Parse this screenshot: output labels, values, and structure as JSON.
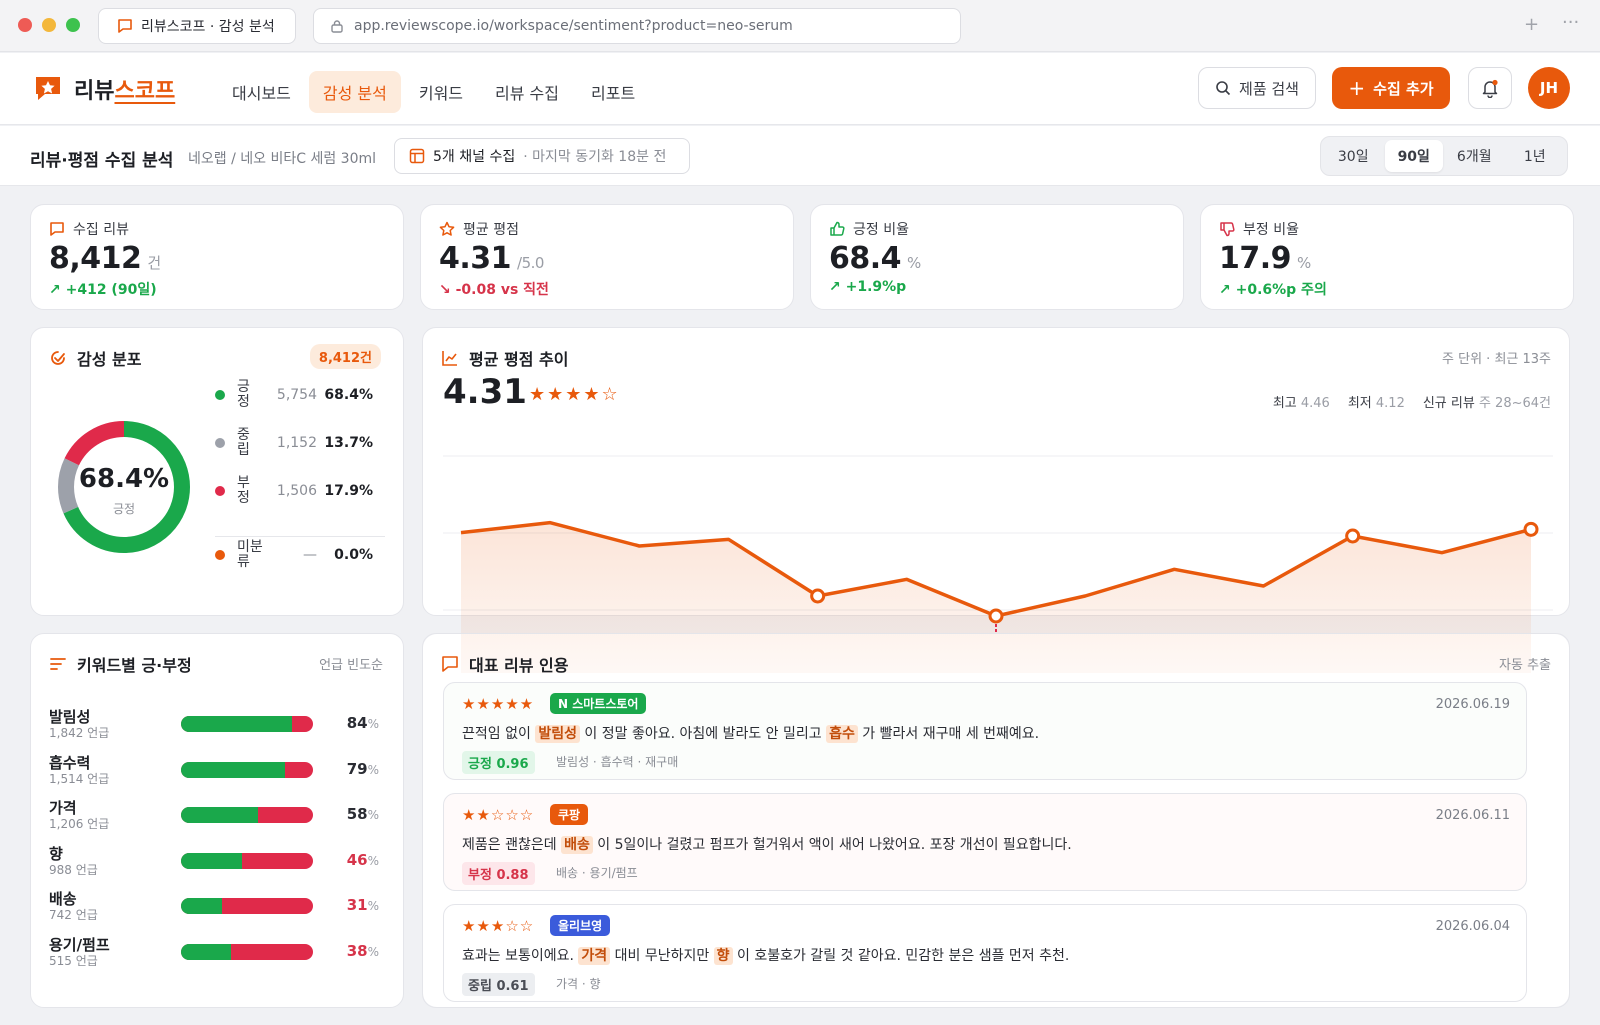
{
  "browser": {
    "tab_title": "리뷰스코프 · 감성 분석",
    "url": "app.reviewscope.io/workspace/sentiment?product=neo-serum"
  },
  "nav": {
    "logo_main": "리뷰",
    "logo_accent": "스코프",
    "items": [
      "대시보드",
      "감성 분석",
      "키워드",
      "리뷰 수집",
      "리포트"
    ],
    "active": 1,
    "search_label": "제품 검색",
    "add_label": "수집 추가",
    "avatar": "JH"
  },
  "subbar": {
    "title": "리뷰·평점 수집 분석",
    "path": "네오랩 / 네오 비타C 세럼 30ml",
    "chip_main": "5개 채널 수집",
    "chip_sub": "· 마지막 동기화 18분 전",
    "ranges": [
      "30일",
      "90일",
      "6개월",
      "1년"
    ],
    "range_selected": 1
  },
  "kpis": [
    {
      "label": "수집 리뷰",
      "value": "8,412",
      "unit": "건",
      "delta": "↗ +412 (90일)",
      "dir": "up",
      "icon": "message-icon"
    },
    {
      "label": "평균 평점",
      "value": "4.31",
      "unit": "/5.0",
      "delta": "↘ -0.08 vs 직전",
      "dir": "down",
      "icon": "star-icon"
    },
    {
      "label": "긍정 비율",
      "value": "68.4",
      "unit": "%",
      "delta": "↗ +1.9%p",
      "dir": "up",
      "icon": "thumbs-up-icon"
    },
    {
      "label": "부정 비율",
      "value": "17.9",
      "unit": "%",
      "delta": "↗ +0.6%p 주의",
      "dir": "up",
      "icon": "thumbs-down-icon"
    }
  ],
  "sentiment": {
    "title": "감성 분포",
    "badge": "8,412건",
    "center_value": "68.4%",
    "center_label": "긍정",
    "rows": [
      {
        "name": "긍정",
        "count": "5,754",
        "pct": "68.4%",
        "color": "#1aa84b",
        "share": 68.4
      },
      {
        "name": "중립",
        "count": "1,152",
        "pct": "13.7%",
        "color": "#9da1aa",
        "share": 13.7
      },
      {
        "name": "부정",
        "count": "1,506",
        "pct": "17.9%",
        "color": "#e02a4a",
        "share": 17.9
      },
      {
        "name": "미분류",
        "count": "—",
        "pct": "0.0%",
        "color": "#e8590c",
        "share": 0
      }
    ]
  },
  "trend": {
    "title": "평균 평점 추이",
    "note": "주 단위 · 최근 13주",
    "value": "4.31",
    "stars": "★★★★☆",
    "max_label": "최고",
    "max_value": "4.46",
    "min_label": "최저",
    "min_value": "4.12",
    "new_label": "신규 리뷰",
    "new_value": "주 28~64건"
  },
  "chart_data": {
    "type": "line",
    "series": [
      {
        "values": [
          4.37,
          4.4,
          4.33,
          4.35,
          4.18,
          4.23,
          4.12,
          4.18,
          4.26,
          4.21,
          4.36,
          4.31,
          4.38
        ]
      }
    ],
    "ylim": [
      4.0,
      4.6
    ],
    "grid": true,
    "markers": [
      4,
      6,
      10,
      12
    ]
  },
  "keywords": {
    "title": "키워드별 긍·부정",
    "note": "언급 빈도순",
    "items": [
      {
        "name": "발림성",
        "mentions": "1,842 언급",
        "pct": "84",
        "tone": "pos"
      },
      {
        "name": "흡수력",
        "mentions": "1,514 언급",
        "pct": "79",
        "tone": "pos"
      },
      {
        "name": "가격",
        "mentions": "1,206 언급",
        "pct": "58",
        "tone": "pos"
      },
      {
        "name": "향",
        "mentions": "988 언급",
        "pct": "46",
        "tone": "neg"
      },
      {
        "name": "배송",
        "mentions": "742 언급",
        "pct": "31",
        "tone": "neg"
      },
      {
        "name": "용기/펌프",
        "mentions": "515 언급",
        "pct": "38",
        "tone": "neg"
      }
    ]
  },
  "quotes": {
    "title": "대표 리뷰 인용",
    "note": "자동 추출",
    "items": [
      {
        "stars": "★★★★★",
        "source": "N 스마트스토어",
        "source_color": "#1aa84b",
        "date": "2026.06.19",
        "parts": [
          "끈적임 없이 ",
          "발림성",
          " 이 정말 좋아요. 아침에 발라도 안 밀리고 ",
          "흡수",
          " 가 빨라서 재구매 세 번째예요."
        ],
        "score": "긍정 0.96",
        "score_color": "#1aa84b",
        "score_bg": "#e2f6e9",
        "tags": "발림성 · 흡수력 · 재구매",
        "bg": "#fbfdfb"
      },
      {
        "stars": "★★☆☆☆",
        "source": "쿠팡",
        "source_color": "#e8590c",
        "date": "2026.06.11",
        "parts": [
          "제품은 괜찮은데 ",
          "배송",
          " 이 5일이나 걸렸고 펌프가 헐거워서 액이 새어 나왔어요. 포장 개선이 필요합니다.",
          "",
          ""
        ],
        "score": "부정 0.88",
        "score_color": "#d6344a",
        "score_bg": "#fde6ea",
        "tags": "배송 · 용기/펌프",
        "bg": "#fffafa"
      },
      {
        "stars": "★★★☆☆",
        "source": "올리브영",
        "source_color": "#3b5bdb",
        "date": "2026.06.04",
        "parts": [
          "효과는 보통이에요. ",
          "가격",
          " 대비 무난하지만 ",
          "향",
          " 이 호불호가 갈릴 것 같아요. 민감한 분은 샘플 먼저 추천."
        ],
        "score": "중립 0.61",
        "score_color": "#4a4d55",
        "score_bg": "#eceef1",
        "tags": "가격 · 향",
        "bg": "#ffffff"
      }
    ]
  }
}
